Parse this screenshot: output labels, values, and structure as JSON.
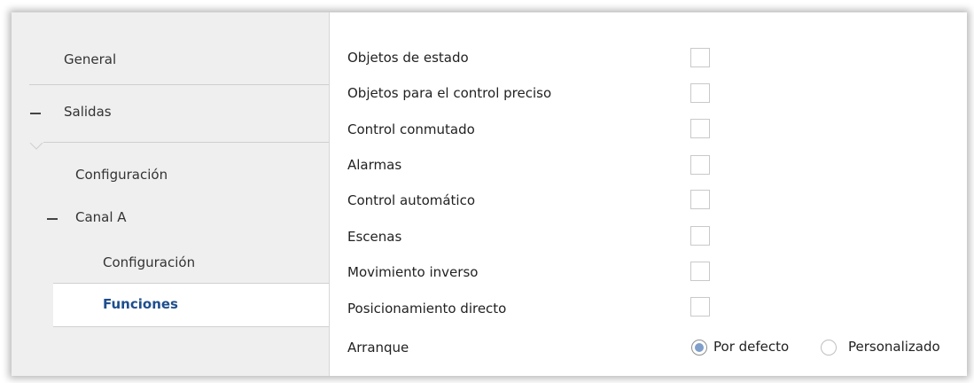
{
  "sidebar": {
    "items": [
      {
        "label": "General"
      },
      {
        "label": "Salidas"
      },
      {
        "label": "Configuración"
      },
      {
        "label": "Canal A"
      },
      {
        "label": "Configuración"
      },
      {
        "label": "Funciones"
      }
    ]
  },
  "main": {
    "options": [
      {
        "label": "Objetos de estado",
        "checked": false
      },
      {
        "label": "Objetos para el control preciso",
        "checked": false
      },
      {
        "label": "Control conmutado",
        "checked": false
      },
      {
        "label": "Alarmas",
        "checked": false
      },
      {
        "label": "Control automático",
        "checked": false
      },
      {
        "label": "Escenas",
        "checked": false
      },
      {
        "label": "Movimiento inverso",
        "checked": false
      },
      {
        "label": "Posicionamiento directo",
        "checked": false
      }
    ],
    "arranque": {
      "label": "Arranque",
      "options": [
        "Por defecto",
        "Personalizado"
      ],
      "selected": "Por defecto"
    }
  },
  "colors": {
    "active_link": "#1f4e8c",
    "radio_selected": "#7f9ec9",
    "sidebar_bg": "#efefef"
  }
}
